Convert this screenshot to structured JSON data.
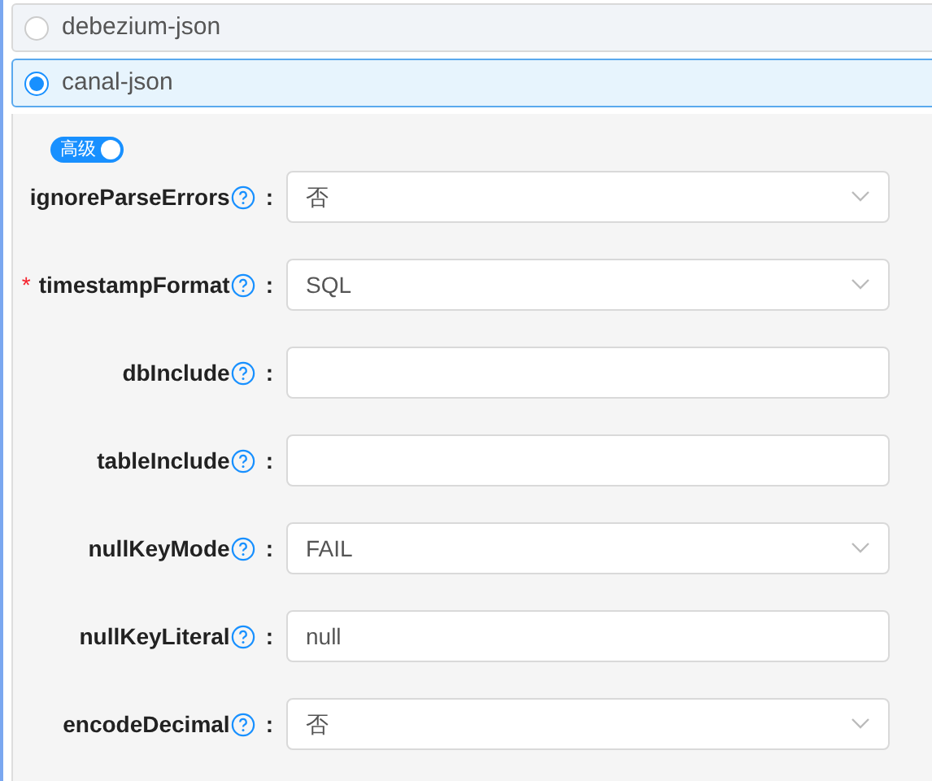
{
  "formats": [
    {
      "label": "debezium-json",
      "selected": false
    },
    {
      "label": "canal-json",
      "selected": true
    }
  ],
  "advanced": {
    "label": "高级",
    "on": true
  },
  "fields": [
    {
      "label": "ignoreParseErrors",
      "required": false,
      "kind": "select",
      "value": "否"
    },
    {
      "label": "timestampFormat",
      "required": true,
      "kind": "select",
      "value": "SQL"
    },
    {
      "label": "dbInclude",
      "required": false,
      "kind": "input"
    },
    {
      "label": "tableInclude",
      "required": false,
      "kind": "input"
    },
    {
      "label": "nullKeyMode",
      "required": false,
      "kind": "select",
      "value": "FAIL"
    },
    {
      "label": "nullKeyLiteral",
      "required": false,
      "kind": "input",
      "value": "null"
    },
    {
      "label": "encodeDecimal",
      "required": false,
      "kind": "select",
      "value": "否"
    }
  ],
  "colon": ":",
  "required_mark": "*"
}
